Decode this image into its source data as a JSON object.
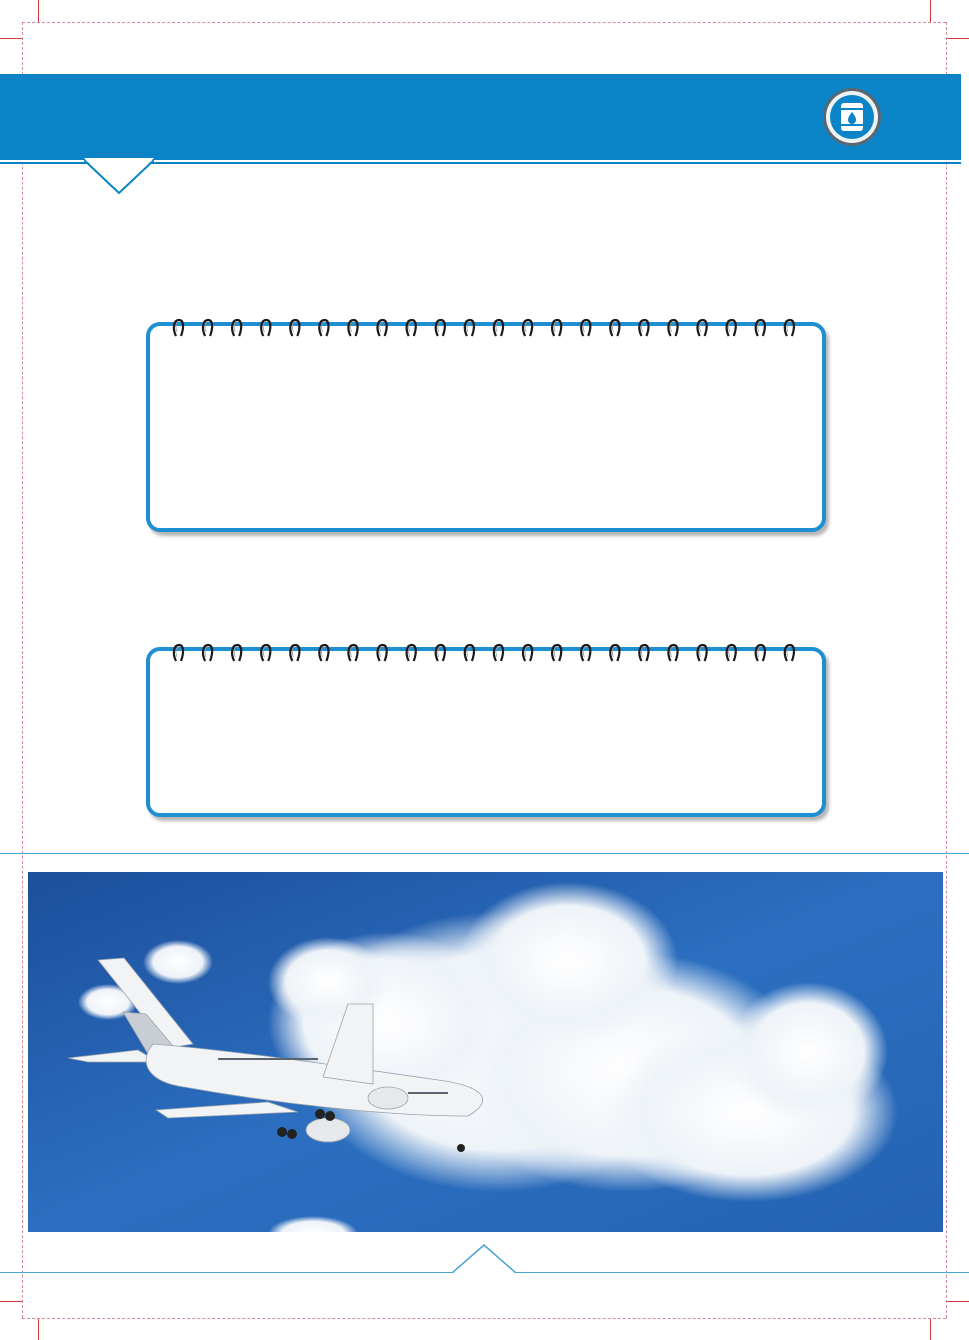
{
  "page": {
    "header": {
      "band_color": "#0a84c6",
      "badge_icon": "oil-barrel-icon"
    },
    "note_cards": [
      {
        "id": "card-1",
        "border_color": "#1e8fd1"
      },
      {
        "id": "card-2",
        "border_color": "#1e8fd1"
      }
    ],
    "photo": {
      "subject": "airplane-in-sky"
    },
    "colors": {
      "accent": "#0a84c6",
      "crop_mark": "#d9353b",
      "sky": "#1f5fae"
    }
  }
}
